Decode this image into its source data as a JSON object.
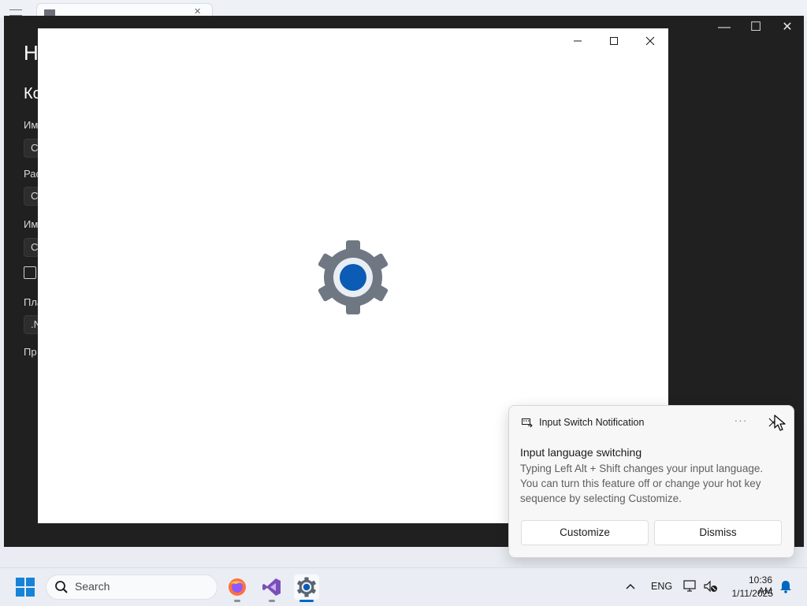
{
  "background_window": {
    "title_fragment": "Н",
    "section_fragment": "Ко",
    "label1": "Им",
    "field1": "C",
    "label2": "Рас",
    "field2": "C",
    "label3": "Им",
    "field3": "C",
    "label4": "Пла",
    "field4": ".N",
    "label5": "Пр"
  },
  "notification": {
    "app_name": "Input Switch Notification",
    "more_label": "···",
    "heading": "Input language switching",
    "body": "Typing Left Alt + Shift changes your input language. You can turn this feature off or change your hot key sequence by selecting Customize.",
    "customize_label": "Customize",
    "dismiss_label": "Dismiss"
  },
  "taskbar": {
    "search_label": "Search",
    "language": "ENG",
    "time": "10:36 AM",
    "date": "1/11/2025",
    "apps": [
      {
        "name": "firefox-icon",
        "color": "#ff7139"
      },
      {
        "name": "visual-studio-icon",
        "color": "#7b4fb8"
      },
      {
        "name": "settings-icon",
        "color": "#5b6470"
      }
    ]
  },
  "colors": {
    "accent": "#0067c0",
    "gear_body": "#6f7782",
    "gear_center": "#0c5bb4"
  }
}
